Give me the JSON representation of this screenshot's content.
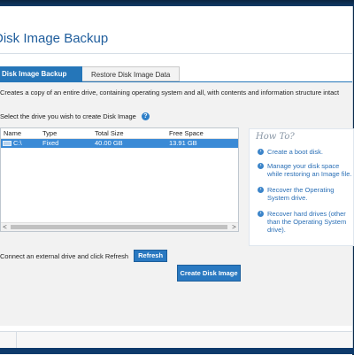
{
  "window": {
    "title": "Disk Image Backup"
  },
  "tabs": [
    {
      "label": "Disk Image Backup"
    },
    {
      "label": "Restore Disk Image Data"
    }
  ],
  "description": "Creates a copy of an entire drive, containing operating system and all, with contents and information structure intact",
  "select_drive_label": "Select the drive you wish to create Disk Image",
  "drive_table": {
    "columns": [
      "Name",
      "Type",
      "Total Size",
      "Free Space"
    ],
    "rows": [
      {
        "name": "C:\\",
        "type": "Fixed",
        "total": "40.00 GB",
        "free": "13.91 GB",
        "selected": true
      }
    ],
    "scroll_left": "<",
    "scroll_right": ">"
  },
  "howto": {
    "title": "How To?",
    "items": [
      "Create a boot disk.",
      "Manage your disk space while restoring an Image file.",
      "Recover the Operating System drive.",
      "Recover hard drives (other than the Operating System drive)."
    ]
  },
  "external_drive_text": "Connect an external drive and click Refresh",
  "refresh_label": "Refresh",
  "create_label": "Create Disk Image",
  "colors": {
    "accent": "#2576b9",
    "selection": "#3a8ad6",
    "link": "#2a6fb6"
  },
  "icons": {
    "help": "question-icon",
    "drive": "hard-drive-icon",
    "bullet": "arrow-bullet-icon"
  }
}
